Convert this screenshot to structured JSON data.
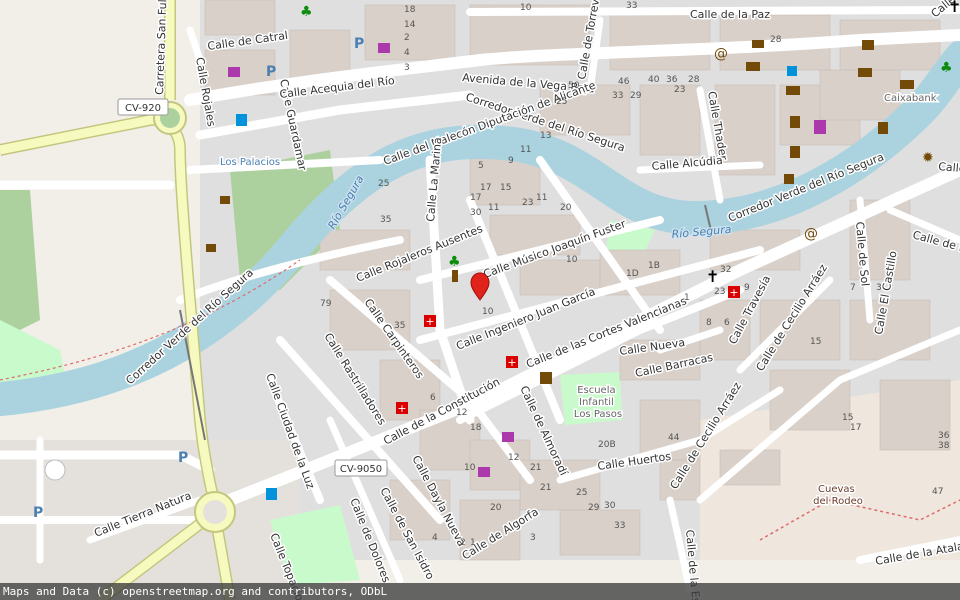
{
  "map": {
    "colors": {
      "land": "#f2efe9",
      "building": "#d9d0c9",
      "river": "#aad3df",
      "road": "#ffffff",
      "trunk": "#f7fabf",
      "trunk_casing": "#c4c67f",
      "park": "#c8facc",
      "grass": "#add19e",
      "marker": "#e0241c"
    },
    "streets": {
      "calle_de_la_paz": "Calle de la Paz",
      "calle_de_catral": "Calle de Catral",
      "calle_rojales": "Calle Rojales",
      "calle_guardamar": "Calle Guardamar",
      "carretera_san_fulgencio": "Carretera San Fulg",
      "calle_acequia_del_rio": "Calle Acequia del Río",
      "avenida_vega_baja": "Avenida de la Vega Baja",
      "calle_de_torrevieja": "Calle de Torrevieja",
      "corredor_verde_top": "Corredor Verde del Río Segura",
      "calle_del_malecon": "Calle del Malecón Diputación de Alicante",
      "calle_thader": "Calle Thader",
      "calle_alcudia": "Calle Alcúdia",
      "calle_la_marina": "Calle La Marina",
      "calle_rojaleros_ausentes": "Calle Rojaleros Ausentes",
      "calle_musico_joaquin_fuster": "Calle Músico Joaquín Fuster",
      "calle_ingeniero_juan_garcia": "Calle Ingeniero Juan García",
      "calle_cortes_valencianas": "Calle de las Cortes Valencianas",
      "corredor_verde_right": "Corredor Verde del Río Segura",
      "corredor_verde_left": "Corredor Verde del Río Segura",
      "calle_carpinteros": "Calle Carpinteros",
      "calle_rastrilladores": "Calle Rastrilladores",
      "calle_ciudad_de_la_luz": "Calle Ciudad de la Luz",
      "calle_de_la_constitucion": "Calle de la Constitución",
      "calle_de_almoradi": "Calle de Almoradí",
      "calle_dayla_nueva": "Calle Dayla Nueva",
      "calle_de_san_isidro": "Calle de San Isidro",
      "calle_de_dolores": "Calle de Dolores",
      "calle_de_algorfa": "Calle de Algorfa",
      "calle_huertos": "Calle Huertos",
      "calle_de_cecilio_arraez": "Calle de Cecilio Arráez",
      "calle_nueva": "Calle Nueva",
      "calle_barracas": "Calle Barracas",
      "calle_travesia": "Calle Travesía",
      "calle_de_cecilio_arraez_2": "Calle de Cecilio Arráez",
      "calle_de_sol": "Calle de Sol",
      "calle_el_castillo": "Calle El Castillo",
      "calle_tierra_natura": "Calle Tierra Natura",
      "calle_topacio": "Calle Topacio",
      "calle_de_la_atalaya": "Calle de la Atalaya",
      "calle_de_la_esc": "Calle de la Esc",
      "calle_de_la_right": "Calle de la",
      "calle_de_la_right2": "Calle de la",
      "calle_right_top": "Calle"
    },
    "rivers": {
      "rio_segura_1": "Río Segura",
      "rio_segura_2": "Río Segura"
    },
    "shields": {
      "cv920": "CV-920",
      "cv9050": "CV-9050"
    },
    "places": {
      "los_palacios": "Los Palacios",
      "caixabank": "Caixabank",
      "escuela_infantil": "Escuela Infantil Los Pasos",
      "cuevas_del_rodeo": "Cuevas del Rodeo"
    },
    "house_numbers": [
      "18",
      "14",
      "2",
      "4",
      "3",
      "10",
      "33",
      "28",
      "50",
      "46",
      "40",
      "36",
      "28",
      "29",
      "25",
      "33",
      "23",
      "13",
      "11",
      "9",
      "5",
      "17",
      "15",
      "11",
      "23",
      "17",
      "30",
      "20",
      "11",
      "10",
      "1D",
      "1B",
      "32",
      "23",
      "9",
      "7",
      "3",
      "1",
      "8",
      "6",
      "15",
      "10",
      "12",
      "20",
      "21",
      "25",
      "29",
      "30",
      "33",
      "20B",
      "44",
      "36",
      "38",
      "47",
      "79",
      "35",
      "25",
      "35",
      "6",
      "12",
      "18",
      "21",
      "4",
      "2",
      "17",
      "15",
      "1",
      "3",
      "10"
    ],
    "icons": [
      "parking-icon",
      "shop-icon",
      "fuel-icon",
      "bank-icon",
      "pharmacy-icon",
      "church-icon",
      "atm-icon",
      "internet-icon",
      "playground-icon",
      "taxi-icon",
      "viewpoint-icon",
      "museum-icon",
      "bus-icon",
      "police-icon",
      "map-marker-icon"
    ]
  },
  "attribution": "Maps and Data (c) openstreetmap.org and contributors, ODbL"
}
